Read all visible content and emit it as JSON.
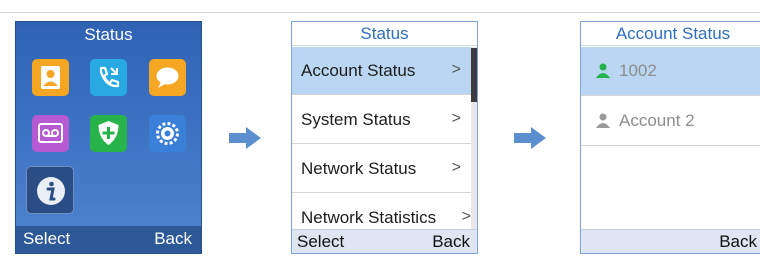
{
  "screen_home": {
    "title": "Status",
    "softkey_left": "Select",
    "softkey_right": "Back",
    "tiles": [
      {
        "icon": "contacts-icon",
        "color": "#f5a623"
      },
      {
        "icon": "call-history-icon",
        "color": "#29a9e1"
      },
      {
        "icon": "messages-icon",
        "color": "#f5a623"
      },
      {
        "icon": "voicemail-icon",
        "color": "#b65ad2"
      },
      {
        "icon": "security-add-icon",
        "color": "#27b34a"
      },
      {
        "icon": "settings-icon",
        "color": "#3a7fd8"
      },
      {
        "icon": "info-icon",
        "color": "#1f3f77",
        "selected": true
      }
    ]
  },
  "screen_status": {
    "title": "Status",
    "items": [
      {
        "label": "Account Status",
        "selected": true
      },
      {
        "label": "System Status"
      },
      {
        "label": "Network Status"
      },
      {
        "label": "Network Statistics"
      }
    ],
    "chevron": ">",
    "softkey_left": "Select",
    "softkey_right": "Back"
  },
  "screen_account": {
    "title": "Account Status",
    "accounts": [
      {
        "label": "1002",
        "icon": "person-icon",
        "icon_color": "#22b34a",
        "selected": true
      },
      {
        "label": "Account 2",
        "icon": "person-icon",
        "icon_color": "#9a9a9a"
      }
    ],
    "softkey_right": "Back"
  },
  "colors": {
    "accent": "#2f6fc3",
    "selection": "#bad6f2",
    "arrow": "#5b8fd0"
  }
}
